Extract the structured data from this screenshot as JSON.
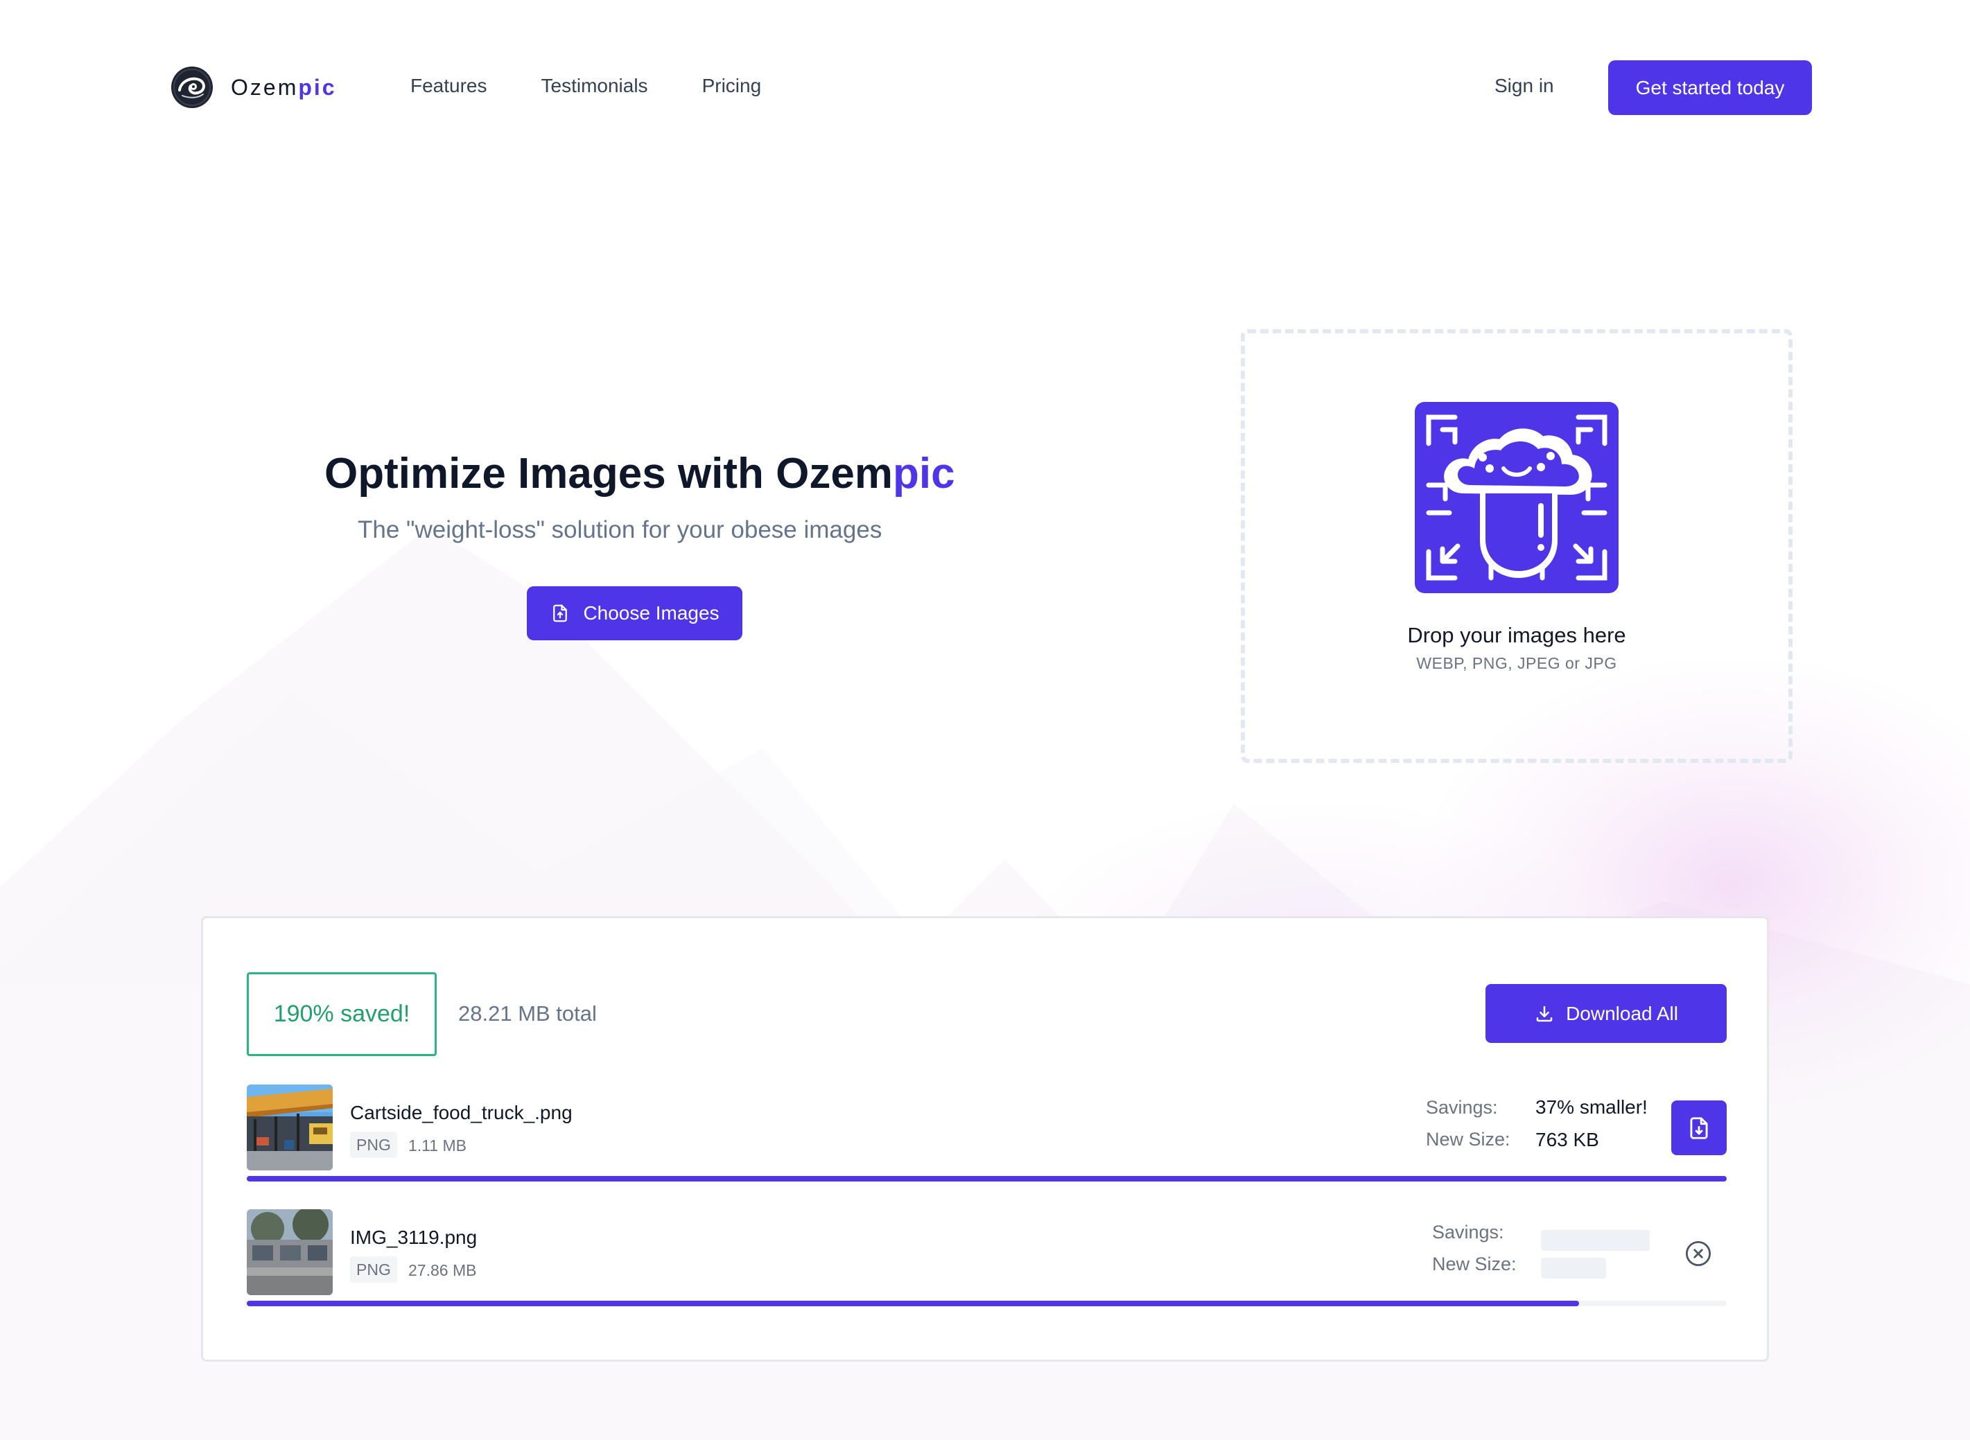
{
  "brand": {
    "name_prefix": "Ozem",
    "name_accent": "pic",
    "accent_color": "#4f35e8"
  },
  "nav": {
    "links": [
      "Features",
      "Testimonials",
      "Pricing"
    ],
    "sign_in": "Sign in",
    "cta": "Get started today"
  },
  "hero": {
    "title_prefix": "Optimize Images with Ozem",
    "title_accent": "pic",
    "subtitle": "The \"weight-loss\" solution for your obese images",
    "choose_button": "Choose Images"
  },
  "dropzone": {
    "title": "Drop your images here",
    "formats": "WEBP, PNG, JPEG or JPG",
    "mascot_icon": "cloud-mascot-icon"
  },
  "results": {
    "saved": "190% saved!",
    "total": "28.21 MB total",
    "download_all": "Download All",
    "savings_label": "Savings:",
    "new_size_label": "New Size:",
    "files": [
      {
        "name": "Cartside_food_truck_.png",
        "type": "PNG",
        "size": "1.11 MB",
        "savings": "37% smaller!",
        "new_size": "763 KB",
        "status": "done",
        "progress": 1.0
      },
      {
        "name": "IMG_3119.png",
        "type": "PNG",
        "size": "27.86 MB",
        "savings": "",
        "new_size": "",
        "status": "processing",
        "progress": 0.9
      }
    ]
  }
}
